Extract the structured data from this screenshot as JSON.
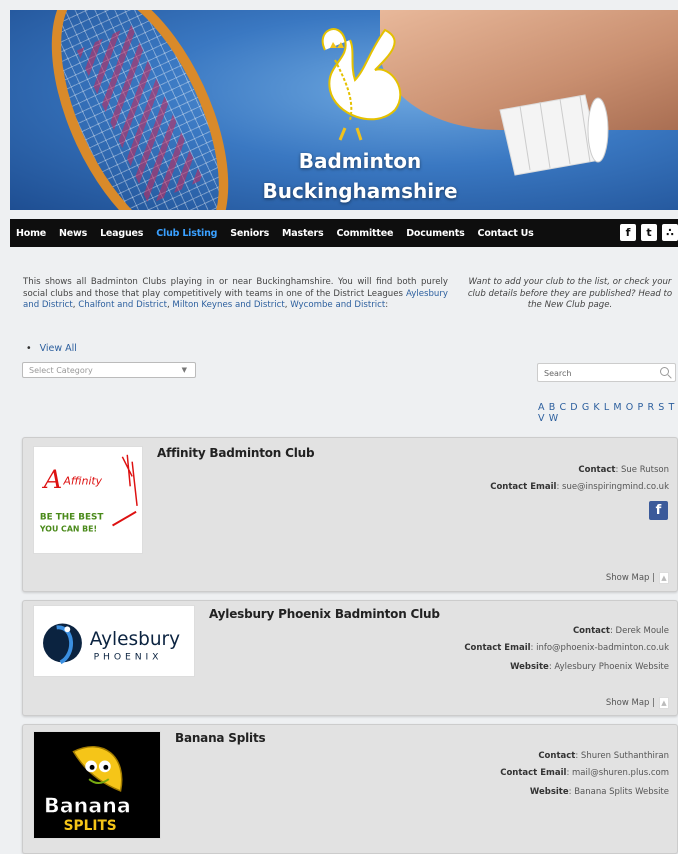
{
  "banner": {
    "title_line1": "Badminton",
    "title_line2": "Buckinghamshire"
  },
  "nav": {
    "items": [
      "Home",
      "News",
      "Leagues",
      "Club Listing",
      "Seniors",
      "Masters",
      "Committee",
      "Documents",
      "Contact Us"
    ],
    "active": "Club Listing",
    "social": [
      "facebook-icon",
      "twitter-icon",
      "rss-icon"
    ]
  },
  "intro": {
    "text": "This shows all Badminton Clubs playing in or near Buckinghamshire. You will find both purely social clubs and those that play competitively with teams in one of the District Leagues",
    "leagues": [
      "Aylesbury and District",
      "Chalfont and District",
      "Milton Keynes and District",
      "Wycombe and District"
    ],
    "side_note": "Want to add your club to the list, or check your club details before they are published? Head to the New Club page."
  },
  "filters": {
    "view_all": "View All",
    "category_placeholder": "Select Category",
    "search_placeholder": "Search",
    "alphabet": "A B C D G K L M O P R S T V W"
  },
  "labels": {
    "contact": "Contact",
    "contact_email": "Contact Email",
    "website": "Website",
    "show_map": "Show Map |"
  },
  "clubs": [
    {
      "name": "Affinity Badminton Club",
      "contact": "Sue Rutson",
      "email": "sue@inspiringmind.co.uk",
      "logo_text": [
        "Affinity",
        "BE THE BEST",
        "YOU CAN BE!"
      ]
    },
    {
      "name": "Aylesbury Phoenix Badminton Club",
      "contact": "Derek Moule",
      "email": "info@phoenix-badminton.co.uk",
      "website": "Aylesbury Phoenix Website",
      "logo_text": [
        "Aylesbury",
        "PHOENIX"
      ]
    },
    {
      "name": "Banana Splits",
      "contact": "Shuren Suthanthiran",
      "email": "mail@shuren.plus.com",
      "website": "Banana Splits Website",
      "logo_text": [
        "Banana",
        "SPLITS"
      ]
    }
  ],
  "colors": {
    "nav_bg": "#0e0e0e",
    "nav_active": "#3aa0ff",
    "link": "#2c5f9e",
    "facebook": "#3b5a9a"
  }
}
